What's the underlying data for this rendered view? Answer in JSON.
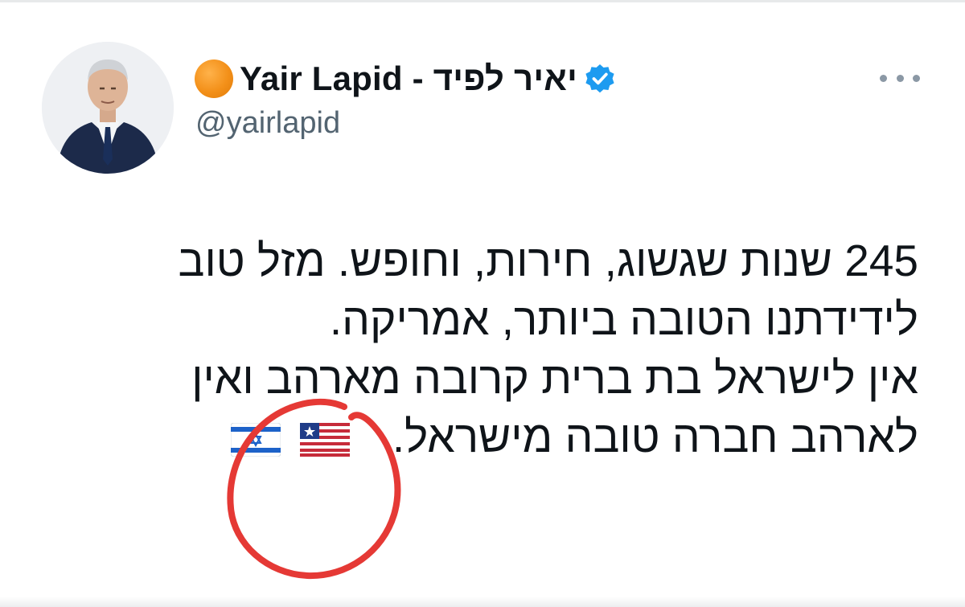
{
  "tweet": {
    "author": {
      "display_name": "Yair Lapid - יאיר לפיד",
      "handle": "@yairlapid",
      "verified": true,
      "badge_icon": "orange-circle-icon",
      "badge_color": "#f39019",
      "verified_color": "#1d9bf0"
    },
    "more_icon": "more-options-icon",
    "lines": [
      "245 שנות שגשוג, חירות, וחופש. מזל טוב",
      "לידידתנו הטובה ביותר, אמריקה.",
      "אין לישראל בת ברית קרובה מארהב ואין",
      "לארהב חברה טובה מישראל."
    ],
    "emoji": [
      "liberia-flag-emoji",
      "israel-flag-emoji"
    ],
    "annotation": {
      "type": "red-hand-drawn-circle",
      "color": "#e53935",
      "target": "liberia-flag-emoji"
    }
  }
}
